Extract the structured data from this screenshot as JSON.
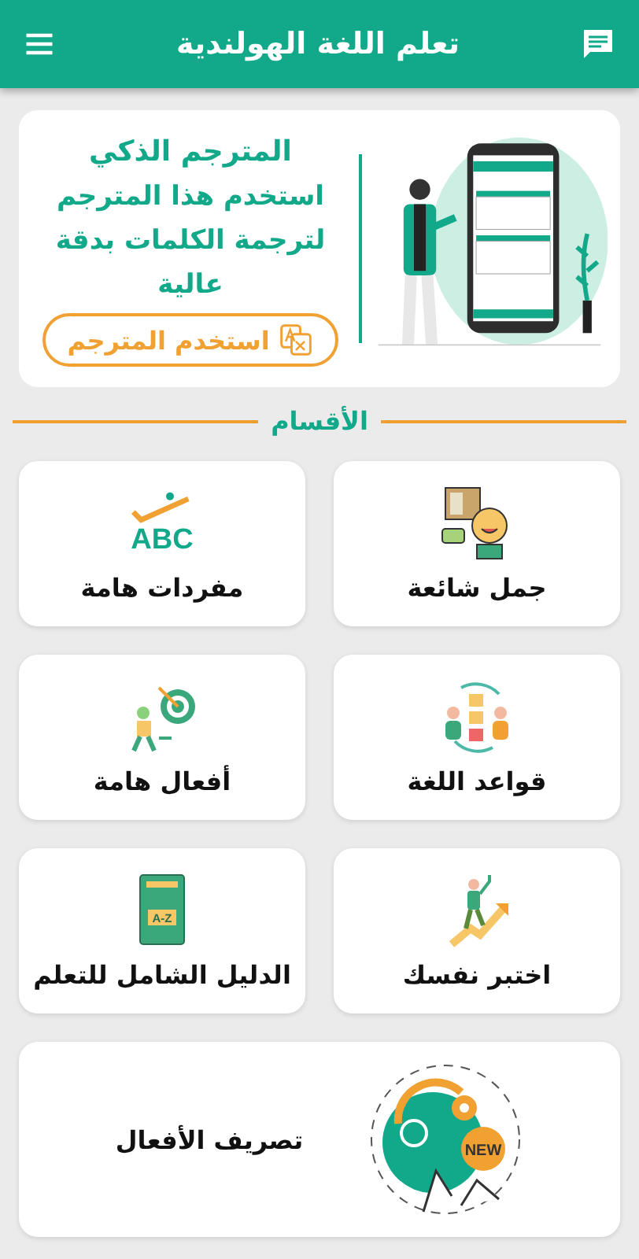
{
  "app_bar": {
    "title": "تعلم اللغة الهولندية"
  },
  "banner": {
    "title": "المترجم الذكي",
    "text": "استخدم هذا المترجم لترجمة الكلمات بدقة عالية",
    "button": "استخدم المترجم"
  },
  "section": {
    "title": "الأقسام"
  },
  "categories": [
    {
      "label": "جمل شائعة",
      "kind": "phrases"
    },
    {
      "label": "مفردات هامة",
      "kind": "abc",
      "icon_text": "ABC"
    },
    {
      "label": "قواعد اللغة",
      "kind": "grammar"
    },
    {
      "label": "أفعال هامة",
      "kind": "target"
    },
    {
      "label": "اختبر نفسك",
      "kind": "climb"
    },
    {
      "label": "الدليل الشامل للتعلم",
      "kind": "book",
      "icon_text": "A-Z"
    },
    {
      "label": "تصريف الأفعال",
      "kind": "gears",
      "icon_text": "NEW"
    }
  ]
}
